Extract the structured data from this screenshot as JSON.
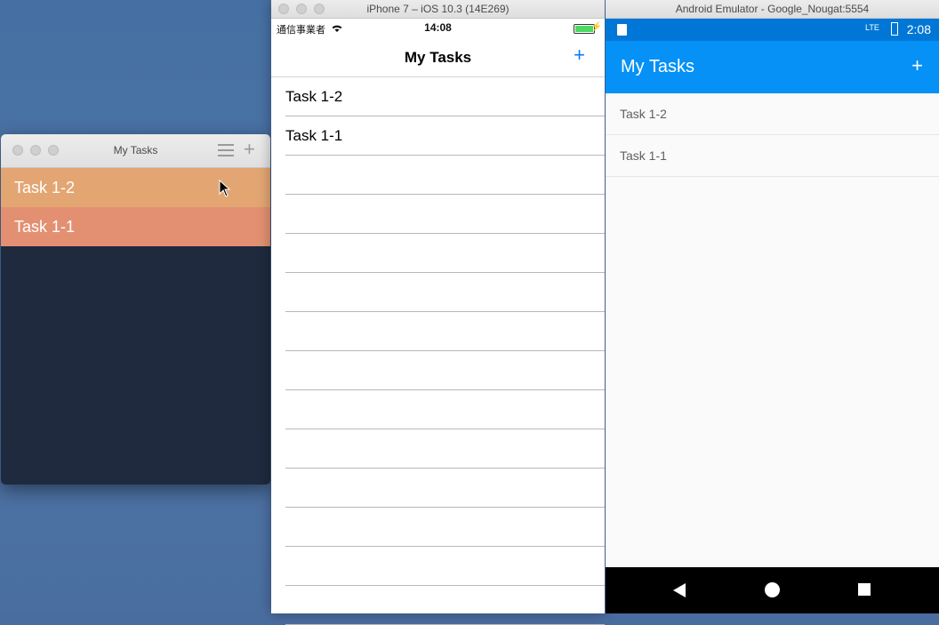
{
  "mac_window": {
    "title": "My Tasks",
    "menu_icon": "hamburger-menu-icon",
    "add_icon": "plus-icon",
    "add_label": "+",
    "rows": [
      {
        "label": "Task 1-2",
        "color": "#e3a673"
      },
      {
        "label": "Task 1-1",
        "color": "#e39072"
      }
    ],
    "background": "#1f2a3e"
  },
  "ios_simulator": {
    "window_title": "iPhone 7 – iOS 10.3 (14E269)",
    "status": {
      "carrier": "通信事業者",
      "time": "14:08",
      "wifi_icon": "wifi-icon",
      "battery_icon": "battery-icon"
    },
    "nav_title": "My Tasks",
    "add_label": "+",
    "rows": [
      {
        "label": "Task 1-2"
      },
      {
        "label": "Task 1-1"
      },
      {
        "label": ""
      },
      {
        "label": ""
      },
      {
        "label": ""
      },
      {
        "label": ""
      },
      {
        "label": ""
      },
      {
        "label": ""
      },
      {
        "label": ""
      },
      {
        "label": ""
      },
      {
        "label": ""
      },
      {
        "label": ""
      },
      {
        "label": ""
      },
      {
        "label": ""
      }
    ],
    "accent": "#0a7aff"
  },
  "android_emulator": {
    "window_title": "Android Emulator - Google_Nougat:5554",
    "status": {
      "network_label": "LTE",
      "time": "2:08",
      "sd_icon": "sd-card-icon",
      "battery_icon": "battery-icon"
    },
    "app_bar_title": "My Tasks",
    "add_label": "+",
    "rows": [
      {
        "label": "Task 1-2"
      },
      {
        "label": "Task 1-1"
      }
    ],
    "app_bar_color": "#0591f5",
    "status_bar_color": "#0077d6",
    "nav_icons": [
      "back-icon",
      "home-icon",
      "recents-icon"
    ]
  }
}
